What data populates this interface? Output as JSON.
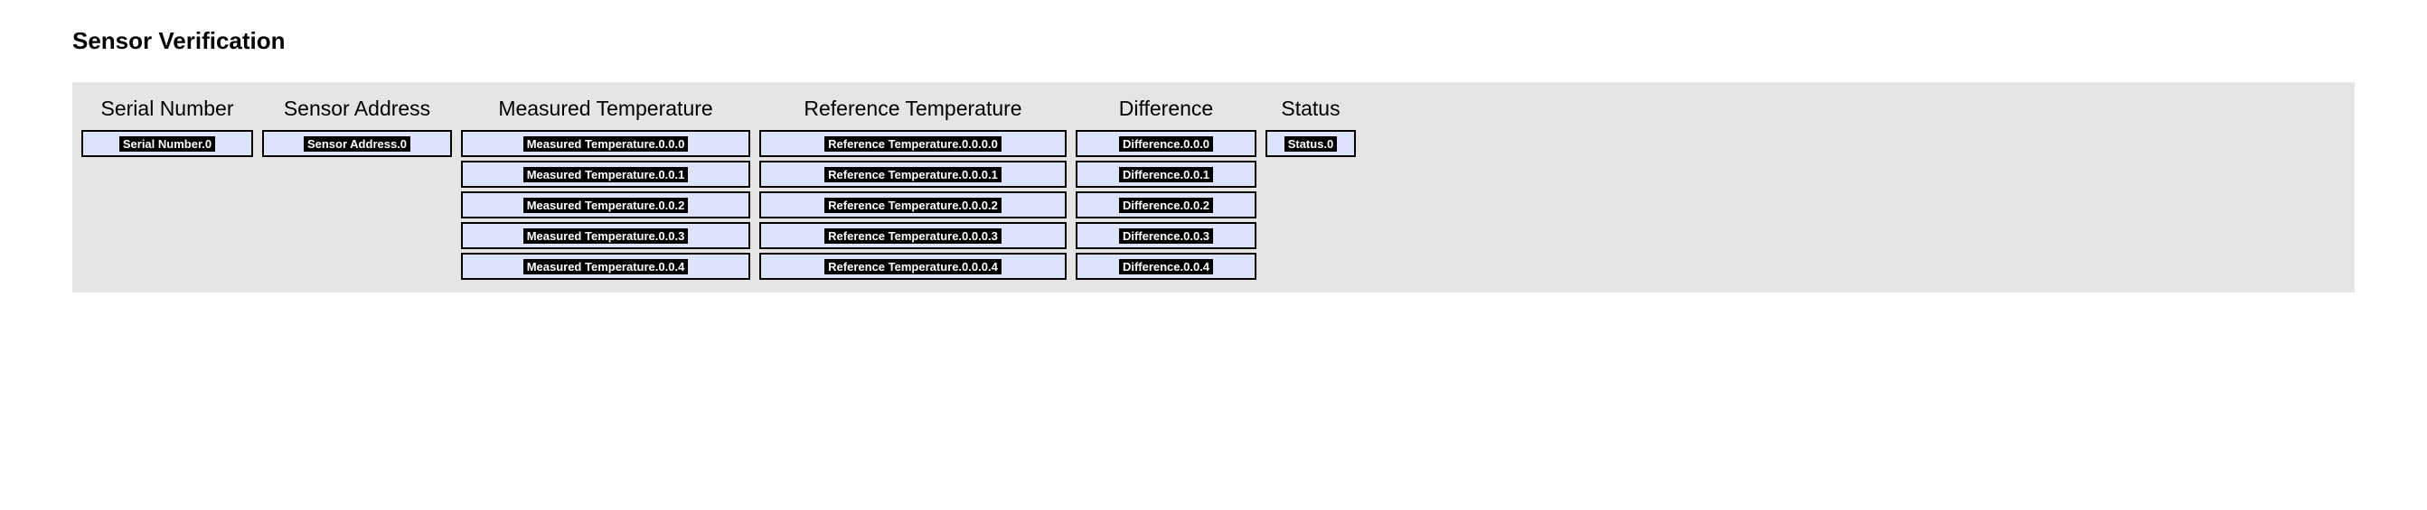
{
  "title": "Sensor Verification",
  "columns": {
    "serial": "Serial Number",
    "address": "Sensor Address",
    "measured": "Measured Temperature",
    "reference": "Reference Temperature",
    "difference": "Difference",
    "status": "Status"
  },
  "rows": {
    "serial": "Serial Number.0",
    "address": "Sensor Address.0",
    "status": "Status.0",
    "measured": [
      "Measured Temperature.0.0.0",
      "Measured Temperature.0.0.1",
      "Measured Temperature.0.0.2",
      "Measured Temperature.0.0.3",
      "Measured Temperature.0.0.4"
    ],
    "reference": [
      "Reference Temperature.0.0.0.0",
      "Reference Temperature.0.0.0.1",
      "Reference Temperature.0.0.0.2",
      "Reference Temperature.0.0.0.3",
      "Reference Temperature.0.0.0.4"
    ],
    "difference": [
      "Difference.0.0.0",
      "Difference.0.0.1",
      "Difference.0.0.2",
      "Difference.0.0.3",
      "Difference.0.0.4"
    ]
  }
}
